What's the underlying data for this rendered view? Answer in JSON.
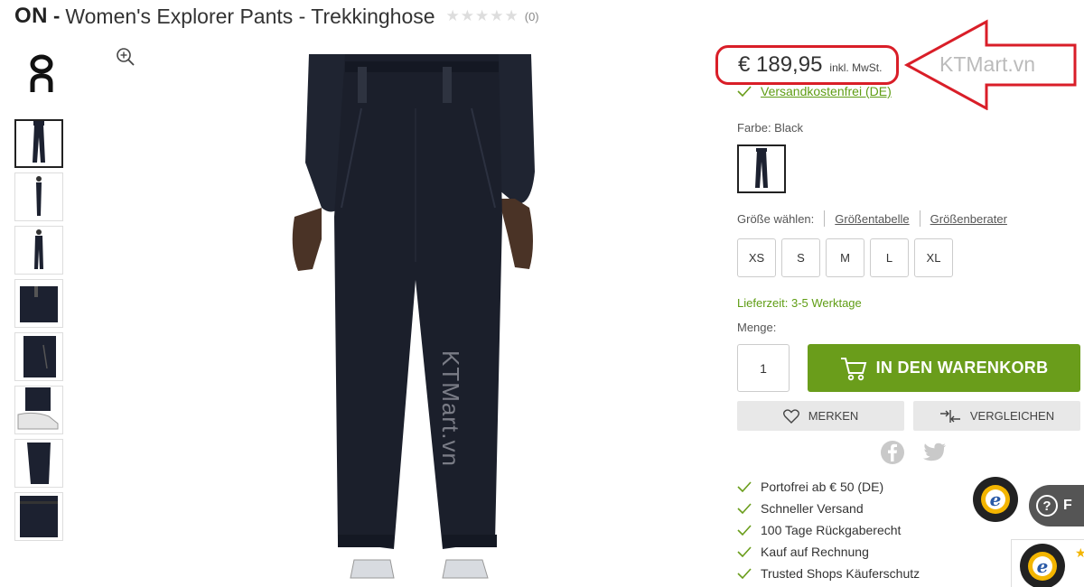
{
  "product": {
    "brand": "ON",
    "separator": "-",
    "name": "Women's Explorer Pants - Trekkinghose",
    "rating_stars": "★★★★★",
    "review_count": "(0)"
  },
  "pricing": {
    "price": "€ 189,95",
    "tax_note": "inkl. MwSt.",
    "shipping_link": "Versandkostenfrei (DE)"
  },
  "watermarks": {
    "side": "KTMart.vn",
    "image": "KTMart.vn"
  },
  "options": {
    "color_label": "Farbe: Black",
    "size_label": "Größe wählen:",
    "size_table_link": "Größentabelle",
    "size_advisor_link": "Größenberater",
    "sizes": [
      "XS",
      "S",
      "M",
      "L",
      "XL"
    ]
  },
  "purchase": {
    "delivery": "Lieferzeit: 3-5 Werktage",
    "quantity_label": "Menge:",
    "quantity_value": "1",
    "add_to_cart": "IN DEN WARENKORB",
    "wishlist": "MERKEN",
    "compare": "VERGLEICHEN"
  },
  "benefits": [
    "Portofrei ab € 50 (DE)",
    "Schneller Versand",
    "100 Tage Rückgaberecht",
    "Kauf auf Rechnung",
    "Trusted Shops Käuferschutz"
  ],
  "help": {
    "label": "F"
  },
  "colors": {
    "accent_green": "#6a9d1b",
    "link_green": "#5f9d14",
    "highlight_red": "#d91e28",
    "product_black": "#1c2130"
  }
}
